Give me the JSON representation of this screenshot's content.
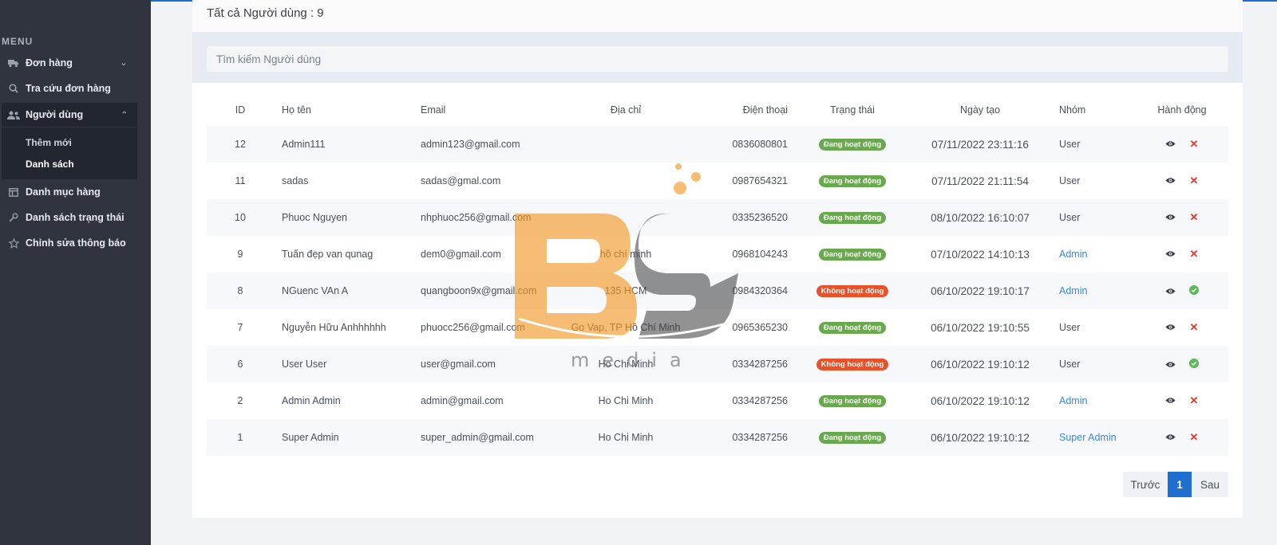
{
  "colors": {
    "sidebar_bg": "#2f343f",
    "accent": "#1f6fd1",
    "status_active": "#6aa84f",
    "status_inactive": "#e8522b",
    "link": "#3f86d6",
    "danger": "#e0392b",
    "success": "#5cb85c"
  },
  "sidebar": {
    "menu_title": "MENU",
    "items": [
      {
        "label": "Đơn hàng",
        "icon": "truck-icon"
      },
      {
        "label": "Tra cứu đơn hàng",
        "icon": "search-icon"
      },
      {
        "label": "Người dùng",
        "icon": "users-icon"
      },
      {
        "label": "Danh mục hàng",
        "icon": "table-icon"
      },
      {
        "label": "Danh sách trạng thái",
        "icon": "wrench-icon"
      },
      {
        "label": "Chỉnh sửa thông báo",
        "icon": "star-icon"
      }
    ],
    "subitems": [
      {
        "label": "Thêm mới"
      },
      {
        "label": "Danh sách"
      }
    ]
  },
  "page": {
    "title": "Tất cả Người dùng : 9"
  },
  "search": {
    "placeholder": "Tìm kiếm Người dùng"
  },
  "table": {
    "columns": [
      "ID",
      "Họ tên",
      "Email",
      "Địa chỉ",
      "Điện thoại",
      "Trạng thái",
      "Ngày tạo",
      "Nhóm",
      "Hành động"
    ],
    "rows": [
      {
        "id": "12",
        "name": "Admin111",
        "email": "admin123@gmail.com",
        "address": "",
        "phone": "0836080801",
        "status": "Đang hoạt động",
        "active": true,
        "created": "07/11/2022 23:11:16",
        "group": "User",
        "group_link": false
      },
      {
        "id": "11",
        "name": "sadas",
        "email": "sadas@gmal.com",
        "address": "",
        "phone": "0987654321",
        "status": "Đang hoạt động",
        "active": true,
        "created": "07/11/2022 21:11:54",
        "group": "User",
        "group_link": false
      },
      {
        "id": "10",
        "name": "Phuoc Nguyen",
        "email": "nhphuoc256@gmail.com",
        "address": "",
        "phone": "0335236520",
        "status": "Đang hoạt động",
        "active": true,
        "created": "08/10/2022 16:10:07",
        "group": "User",
        "group_link": false
      },
      {
        "id": "9",
        "name": "Tuấn đẹp van qunag",
        "email": "dem0@gmail.com",
        "address": "hồ chí minh",
        "phone": "0968104243",
        "status": "Đang hoạt động",
        "active": true,
        "created": "07/10/2022 14:10:13",
        "group": "Admin",
        "group_link": true
      },
      {
        "id": "8",
        "name": "NGuenc VAn A",
        "email": "quangboon9x@gmail.com",
        "address": "135 HCM",
        "phone": "0984320364",
        "status": "Không hoạt động",
        "active": false,
        "created": "06/10/2022 19:10:17",
        "group": "Admin",
        "group_link": true
      },
      {
        "id": "7",
        "name": "Nguyễn Hữu Anhhhhhh",
        "email": "phuocc256@gmail.com",
        "address": "Go Vap, TP Hồ Chí Minh",
        "phone": "0965365230",
        "status": "Đang hoạt động",
        "active": true,
        "created": "06/10/2022 19:10:55",
        "group": "User",
        "group_link": false
      },
      {
        "id": "6",
        "name": "User User",
        "email": "user@gmail.com",
        "address": "Ho Chi Minh",
        "phone": "0334287256",
        "status": "Không hoạt động",
        "active": false,
        "created": "06/10/2022 19:10:12",
        "group": "User",
        "group_link": false
      },
      {
        "id": "2",
        "name": "Admin Admin",
        "email": "admin@gmail.com",
        "address": "Ho Chi Minh",
        "phone": "0334287256",
        "status": "Đang hoạt động",
        "active": true,
        "created": "06/10/2022 19:10:12",
        "group": "Admin",
        "group_link": true
      },
      {
        "id": "1",
        "name": "Super Admin",
        "email": "super_admin@gmail.com",
        "address": "Ho Chi Minh",
        "phone": "0334287256",
        "status": "Đang hoạt động",
        "active": true,
        "created": "06/10/2022 19:10:12",
        "group": "Super Admin",
        "group_link": true
      }
    ]
  },
  "pagination": {
    "prev": "Trước",
    "current": "1",
    "next": "Sau"
  },
  "watermark": {
    "text": "media"
  }
}
